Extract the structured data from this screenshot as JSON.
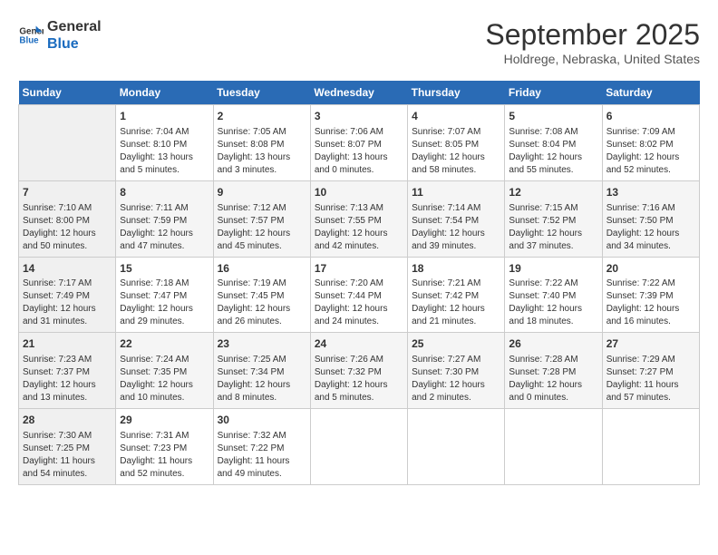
{
  "header": {
    "logo_line1": "General",
    "logo_line2": "Blue",
    "month": "September 2025",
    "location": "Holdrege, Nebraska, United States"
  },
  "weekdays": [
    "Sunday",
    "Monday",
    "Tuesday",
    "Wednesday",
    "Thursday",
    "Friday",
    "Saturday"
  ],
  "weeks": [
    [
      {
        "num": "",
        "info": ""
      },
      {
        "num": "1",
        "info": "Sunrise: 7:04 AM\nSunset: 8:10 PM\nDaylight: 13 hours\nand 5 minutes."
      },
      {
        "num": "2",
        "info": "Sunrise: 7:05 AM\nSunset: 8:08 PM\nDaylight: 13 hours\nand 3 minutes."
      },
      {
        "num": "3",
        "info": "Sunrise: 7:06 AM\nSunset: 8:07 PM\nDaylight: 13 hours\nand 0 minutes."
      },
      {
        "num": "4",
        "info": "Sunrise: 7:07 AM\nSunset: 8:05 PM\nDaylight: 12 hours\nand 58 minutes."
      },
      {
        "num": "5",
        "info": "Sunrise: 7:08 AM\nSunset: 8:04 PM\nDaylight: 12 hours\nand 55 minutes."
      },
      {
        "num": "6",
        "info": "Sunrise: 7:09 AM\nSunset: 8:02 PM\nDaylight: 12 hours\nand 52 minutes."
      }
    ],
    [
      {
        "num": "7",
        "info": "Sunrise: 7:10 AM\nSunset: 8:00 PM\nDaylight: 12 hours\nand 50 minutes."
      },
      {
        "num": "8",
        "info": "Sunrise: 7:11 AM\nSunset: 7:59 PM\nDaylight: 12 hours\nand 47 minutes."
      },
      {
        "num": "9",
        "info": "Sunrise: 7:12 AM\nSunset: 7:57 PM\nDaylight: 12 hours\nand 45 minutes."
      },
      {
        "num": "10",
        "info": "Sunrise: 7:13 AM\nSunset: 7:55 PM\nDaylight: 12 hours\nand 42 minutes."
      },
      {
        "num": "11",
        "info": "Sunrise: 7:14 AM\nSunset: 7:54 PM\nDaylight: 12 hours\nand 39 minutes."
      },
      {
        "num": "12",
        "info": "Sunrise: 7:15 AM\nSunset: 7:52 PM\nDaylight: 12 hours\nand 37 minutes."
      },
      {
        "num": "13",
        "info": "Sunrise: 7:16 AM\nSunset: 7:50 PM\nDaylight: 12 hours\nand 34 minutes."
      }
    ],
    [
      {
        "num": "14",
        "info": "Sunrise: 7:17 AM\nSunset: 7:49 PM\nDaylight: 12 hours\nand 31 minutes."
      },
      {
        "num": "15",
        "info": "Sunrise: 7:18 AM\nSunset: 7:47 PM\nDaylight: 12 hours\nand 29 minutes."
      },
      {
        "num": "16",
        "info": "Sunrise: 7:19 AM\nSunset: 7:45 PM\nDaylight: 12 hours\nand 26 minutes."
      },
      {
        "num": "17",
        "info": "Sunrise: 7:20 AM\nSunset: 7:44 PM\nDaylight: 12 hours\nand 24 minutes."
      },
      {
        "num": "18",
        "info": "Sunrise: 7:21 AM\nSunset: 7:42 PM\nDaylight: 12 hours\nand 21 minutes."
      },
      {
        "num": "19",
        "info": "Sunrise: 7:22 AM\nSunset: 7:40 PM\nDaylight: 12 hours\nand 18 minutes."
      },
      {
        "num": "20",
        "info": "Sunrise: 7:22 AM\nSunset: 7:39 PM\nDaylight: 12 hours\nand 16 minutes."
      }
    ],
    [
      {
        "num": "21",
        "info": "Sunrise: 7:23 AM\nSunset: 7:37 PM\nDaylight: 12 hours\nand 13 minutes."
      },
      {
        "num": "22",
        "info": "Sunrise: 7:24 AM\nSunset: 7:35 PM\nDaylight: 12 hours\nand 10 minutes."
      },
      {
        "num": "23",
        "info": "Sunrise: 7:25 AM\nSunset: 7:34 PM\nDaylight: 12 hours\nand 8 minutes."
      },
      {
        "num": "24",
        "info": "Sunrise: 7:26 AM\nSunset: 7:32 PM\nDaylight: 12 hours\nand 5 minutes."
      },
      {
        "num": "25",
        "info": "Sunrise: 7:27 AM\nSunset: 7:30 PM\nDaylight: 12 hours\nand 2 minutes."
      },
      {
        "num": "26",
        "info": "Sunrise: 7:28 AM\nSunset: 7:28 PM\nDaylight: 12 hours\nand 0 minutes."
      },
      {
        "num": "27",
        "info": "Sunrise: 7:29 AM\nSunset: 7:27 PM\nDaylight: 11 hours\nand 57 minutes."
      }
    ],
    [
      {
        "num": "28",
        "info": "Sunrise: 7:30 AM\nSunset: 7:25 PM\nDaylight: 11 hours\nand 54 minutes."
      },
      {
        "num": "29",
        "info": "Sunrise: 7:31 AM\nSunset: 7:23 PM\nDaylight: 11 hours\nand 52 minutes."
      },
      {
        "num": "30",
        "info": "Sunrise: 7:32 AM\nSunset: 7:22 PM\nDaylight: 11 hours\nand 49 minutes."
      },
      {
        "num": "",
        "info": ""
      },
      {
        "num": "",
        "info": ""
      },
      {
        "num": "",
        "info": ""
      },
      {
        "num": "",
        "info": ""
      }
    ]
  ]
}
